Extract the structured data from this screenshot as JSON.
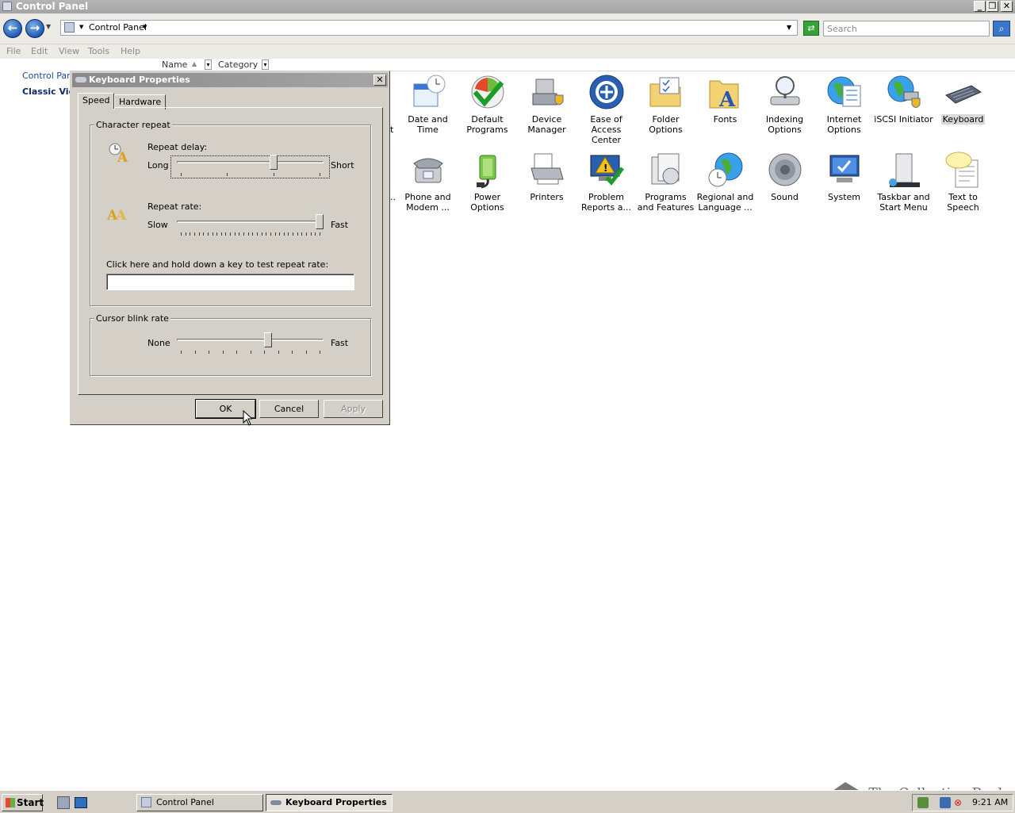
{
  "window": {
    "title": "Control Panel"
  },
  "address": {
    "path": "Control Panel",
    "search_placeholder": "Search"
  },
  "menu": [
    "File",
    "Edit",
    "View",
    "Tools",
    "Help"
  ],
  "columns": {
    "name": "Name",
    "category": "Category"
  },
  "left_nav": {
    "home": "Control Pane",
    "classic": "Classic View"
  },
  "items": [
    {
      "row": 0,
      "col": 0,
      "label": "Date and Time",
      "icon": "calendar-clock-icon"
    },
    {
      "row": 0,
      "col": 1,
      "label": "Default Programs",
      "icon": "default-programs-icon"
    },
    {
      "row": 0,
      "col": 2,
      "label": "Device Manager",
      "icon": "device-manager-icon"
    },
    {
      "row": 0,
      "col": 3,
      "label": "Ease of Access Center",
      "icon": "ease-of-access-icon"
    },
    {
      "row": 0,
      "col": 4,
      "label": "Folder Options",
      "icon": "folder-options-icon"
    },
    {
      "row": 0,
      "col": 5,
      "label": "Fonts",
      "icon": "fonts-folder-icon"
    },
    {
      "row": 0,
      "col": 6,
      "label": "Indexing Options",
      "icon": "indexing-icon"
    },
    {
      "row": 0,
      "col": 7,
      "label": "Internet Options",
      "icon": "internet-globe-icon"
    },
    {
      "row": 0,
      "col": 8,
      "label": "iSCSI Initiator",
      "icon": "iscsi-globe-icon"
    },
    {
      "row": 0,
      "col": 9,
      "label": "Keyboard",
      "icon": "keyboard-icon",
      "selected": true
    },
    {
      "row": 1,
      "col": 0,
      "label": "Phone and Modem ...",
      "icon": "phone-icon"
    },
    {
      "row": 1,
      "col": 1,
      "label": "Power Options",
      "icon": "power-plug-icon"
    },
    {
      "row": 1,
      "col": 2,
      "label": "Printers",
      "icon": "printer-icon"
    },
    {
      "row": 1,
      "col": 3,
      "label": "Problem Reports a...",
      "icon": "problem-reports-icon"
    },
    {
      "row": 1,
      "col": 4,
      "label": "Programs and Features",
      "icon": "programs-icon"
    },
    {
      "row": 1,
      "col": 5,
      "label": "Regional and Language ...",
      "icon": "regional-globe-icon"
    },
    {
      "row": 1,
      "col": 6,
      "label": "Sound",
      "icon": "speaker-icon"
    },
    {
      "row": 1,
      "col": 7,
      "label": "System",
      "icon": "system-monitor-icon"
    },
    {
      "row": 1,
      "col": 8,
      "label": "Taskbar and Start Menu",
      "icon": "taskbar-icon"
    },
    {
      "row": 1,
      "col": 9,
      "label": "Text to Speech",
      "icon": "speech-bubble-icon"
    }
  ],
  "partial_labels": {
    "row0": "t",
    "row1": ".."
  },
  "dialog": {
    "title": "Keyboard Properties",
    "tabs": [
      "Speed",
      "Hardware"
    ],
    "active_tab": "Speed",
    "character_repeat": {
      "group_label": "Character repeat",
      "repeat_delay_label": "Repeat delay:",
      "delay_min": "Long",
      "delay_max": "Short",
      "delay_value": 0.67,
      "delay_ticks": 4,
      "repeat_rate_label": "Repeat rate:",
      "rate_min": "Slow",
      "rate_max": "Fast",
      "rate_value": 1.0,
      "rate_ticks": 32,
      "test_label": "Click here and hold down a key to test repeat rate:",
      "test_value": ""
    },
    "cursor_blink": {
      "group_label": "Cursor blink rate",
      "min": "None",
      "max": "Fast",
      "value": 0.63,
      "ticks": 11
    },
    "buttons": {
      "ok": "OK",
      "cancel": "Cancel",
      "apply": "Apply"
    }
  },
  "taskbar": {
    "start": "Start",
    "tasks": [
      "Control Panel",
      "Keyboard Properties"
    ],
    "clock": "9:21 AM"
  },
  "watermark": "The Collection Book"
}
